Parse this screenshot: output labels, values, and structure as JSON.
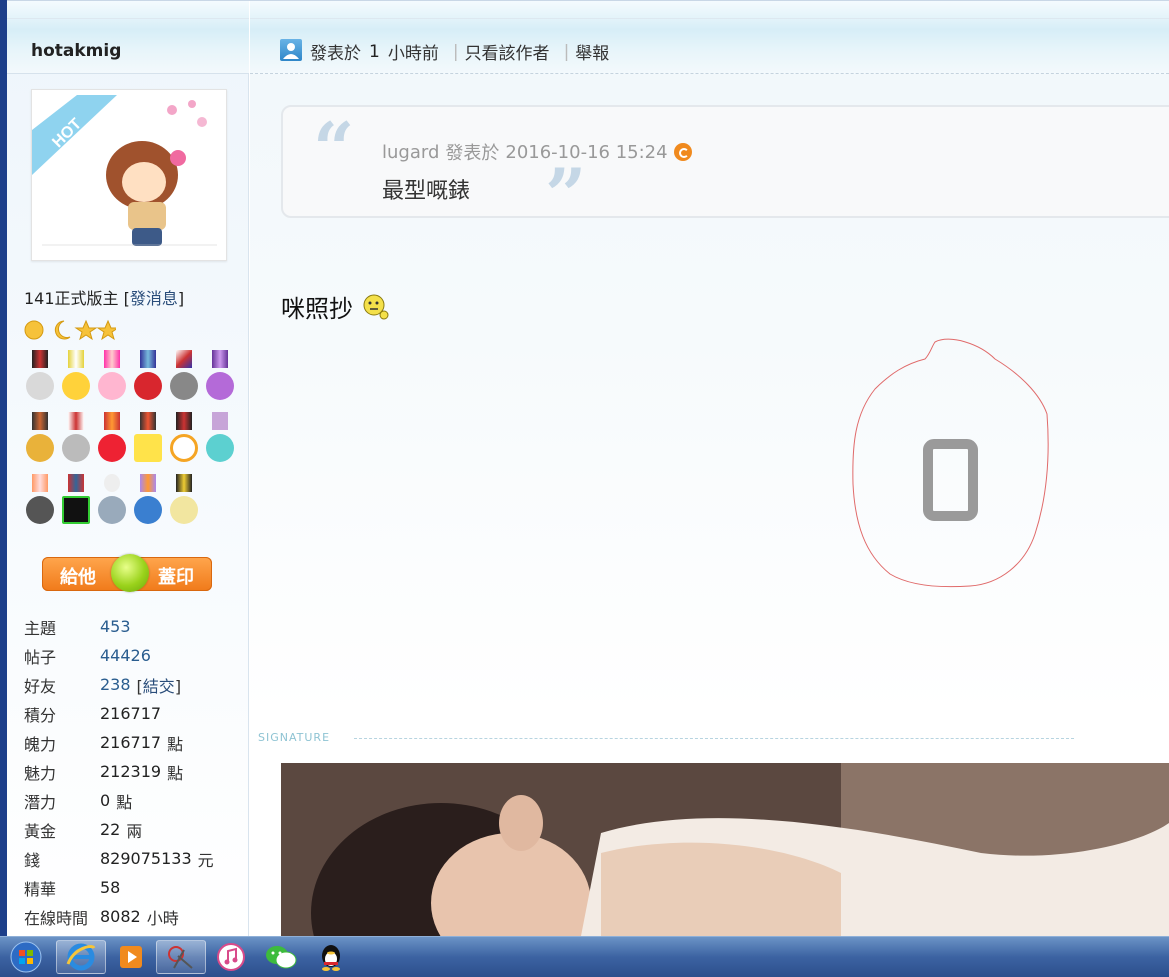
{
  "sidebar": {
    "username": "hotakmig",
    "avatar_text": "HOT",
    "rank": "141正式版主",
    "send_message": "發消息",
    "stamp_button": {
      "left": "給他",
      "right": "蓋印"
    },
    "stats": [
      {
        "label": "主題",
        "value": "453",
        "link": true
      },
      {
        "label": "帖子",
        "value": "44426",
        "link": true
      },
      {
        "label": "好友",
        "value": "238",
        "link": true,
        "extra": "結交"
      },
      {
        "label": "積分",
        "value": "216717"
      },
      {
        "label": "魄力",
        "value": "216717",
        "suffix": "點"
      },
      {
        "label": "魅力",
        "value": "212319",
        "suffix": "點"
      },
      {
        "label": "潛力",
        "value": "0",
        "suffix": "點"
      },
      {
        "label": "黃金",
        "value": "22",
        "suffix": "兩"
      },
      {
        "label": "錢",
        "value": "829075133",
        "suffix": "元"
      },
      {
        "label": "精華",
        "value": "58"
      },
      {
        "label": "在線時間",
        "value": "8082",
        "suffix": "小時"
      }
    ]
  },
  "post": {
    "posted_prefix": "發表於",
    "posted_num": "1",
    "posted_suffix": "小時前",
    "only_author": "只看該作者",
    "report": "舉報",
    "quote": {
      "author": "lugard",
      "posted_label": "發表於",
      "datetime": "2016-10-16 15:24",
      "text": "最型嘅錶"
    },
    "text": "咪照抄",
    "signature_label": "SIGNATURE"
  },
  "colors": {
    "accent_orange": "#f07a1a",
    "link_blue": "#2a5d8f",
    "taskbar": "#3c63a2"
  },
  "taskbar": {
    "items": [
      "start-orb",
      "internet-explorer",
      "media-player",
      "snipping-tool",
      "itunes",
      "wechat",
      "qq"
    ]
  }
}
